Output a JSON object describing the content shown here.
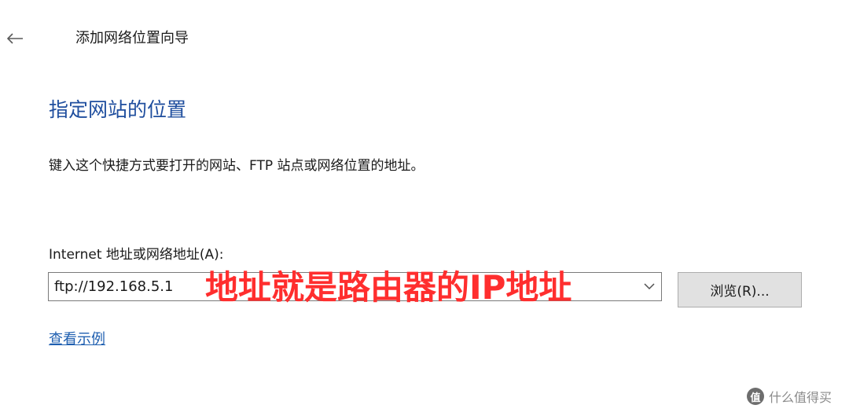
{
  "window": {
    "title": "添加网络位置向导",
    "back_icon": "arrow-left-icon",
    "close_icon": "close-icon"
  },
  "page": {
    "heading": "指定网站的位置",
    "instruction": "键入这个快捷方式要打开的网站、FTP 站点或网络位置的地址。"
  },
  "address_field": {
    "label": "Internet 地址或网络地址(A):",
    "value": "ftp://192.168.5.1",
    "dropdown_icon": "chevron-down-icon"
  },
  "annotation": {
    "text": "地址就是路由器的IP地址",
    "color": "#ff2e2e"
  },
  "browse_button": {
    "label": "浏览(R)..."
  },
  "example_link": {
    "label": "查看示例"
  },
  "watermark": {
    "logo_text": "值",
    "text": "什么值得买"
  },
  "colors": {
    "heading": "#1f4e9e",
    "link": "#1f5fb0",
    "button_bg": "#e1e1e1"
  }
}
